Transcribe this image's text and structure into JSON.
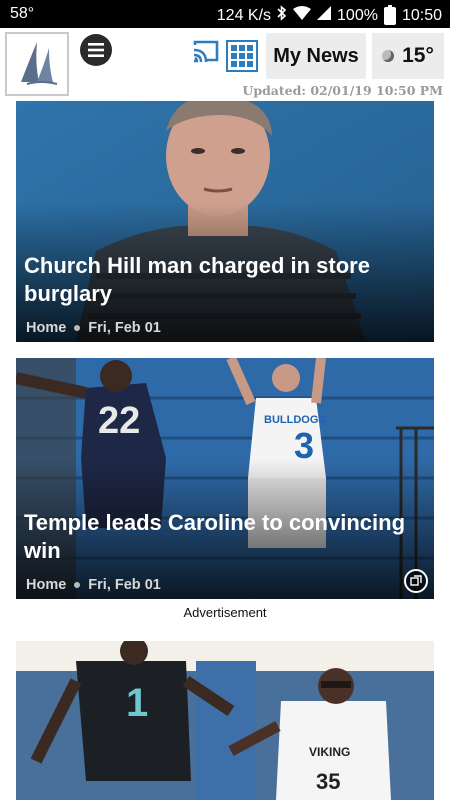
{
  "status_bar": {
    "temp": "58°",
    "speed": "124 K/s",
    "battery": "100%",
    "time": "10:50"
  },
  "header": {
    "my_news": "My News",
    "weather_temp": "15°",
    "updated": "Updated: 02/01/19 10:50 PM"
  },
  "stories": [
    {
      "title": "Church Hill man charged in store burglary",
      "section": "Home",
      "date": "Fri, Feb 01"
    },
    {
      "title": "Temple leads Caroline to convincing win",
      "section": "Home",
      "date": "Fri, Feb 01"
    }
  ],
  "advertisement_label": "Advertisement",
  "colors": {
    "accent": "#2b7dbf",
    "image1_bg": "#2a6ea3",
    "image2_bg": "#2f6aa8"
  },
  "icons": [
    "menu-icon",
    "cast-icon",
    "grid-icon",
    "moon-icon",
    "gallery-icon"
  ]
}
